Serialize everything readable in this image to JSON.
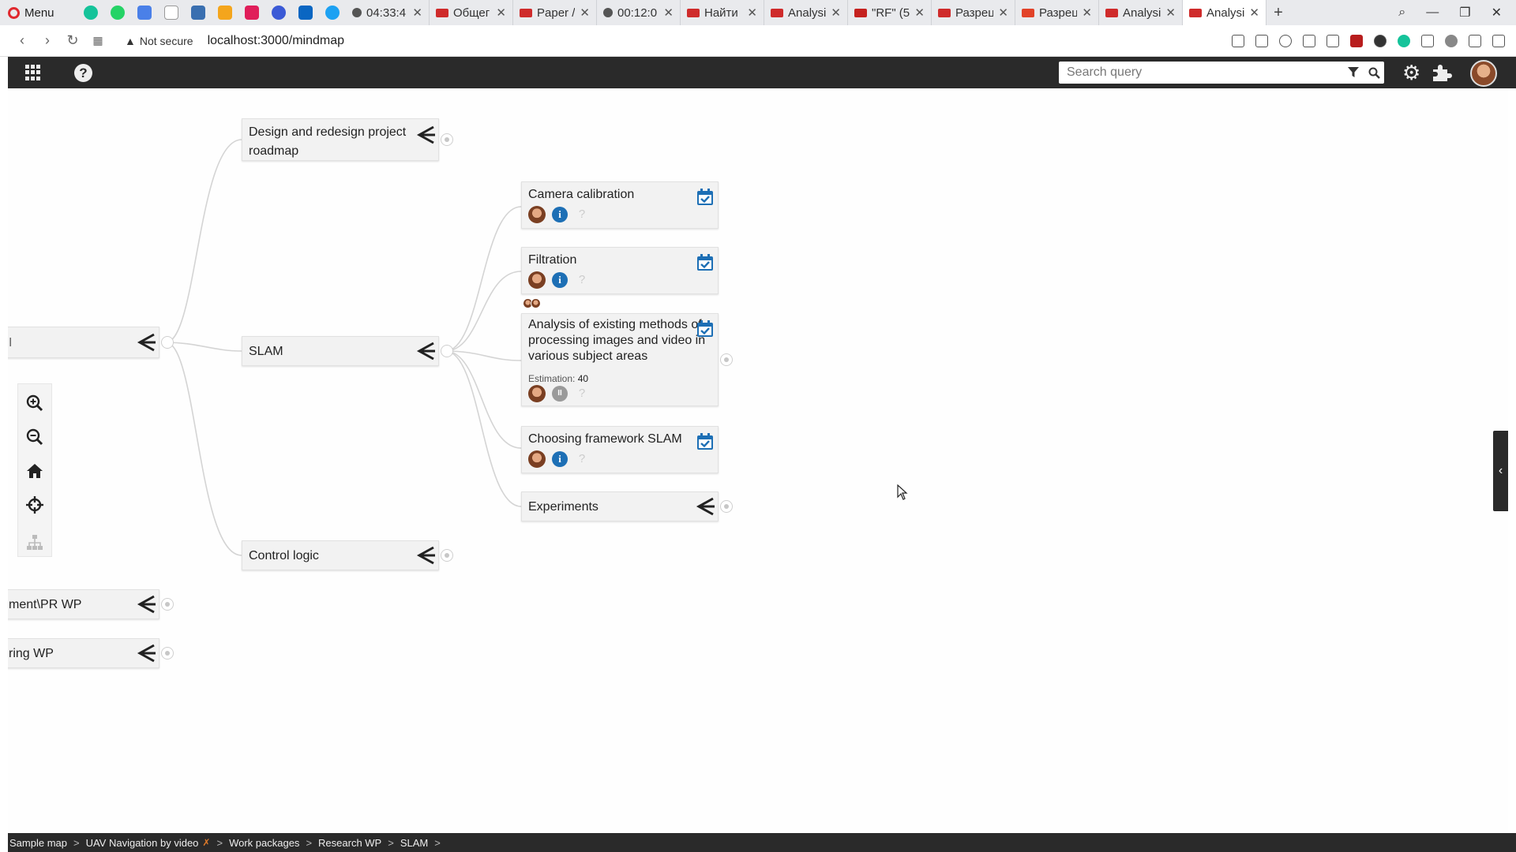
{
  "browser": {
    "menu_label": "Menu",
    "tabs": [
      {
        "title": "04:33:4",
        "type": "clock"
      },
      {
        "title": "Общег",
        "type": "app"
      },
      {
        "title": "Paper /",
        "type": "app"
      },
      {
        "title": "00:12:0",
        "type": "clock"
      },
      {
        "title": "Найти",
        "type": "app"
      },
      {
        "title": "Analysi",
        "type": "app"
      },
      {
        "title": "\"RF\" (5(",
        "type": "mail"
      },
      {
        "title": "Разрец",
        "type": "app"
      },
      {
        "title": "Разрец",
        "type": "gitlab"
      },
      {
        "title": "Analysi",
        "type": "app"
      },
      {
        "title": "Analysi",
        "type": "app",
        "active": true
      }
    ],
    "security_label": "Not secure",
    "url": "localhost:3000/mindmap"
  },
  "appbar": {
    "search_placeholder": "Search query",
    "help_glyph": "?"
  },
  "mindmap": {
    "root_partial": "",
    "root_left_glyph": "I",
    "branch_nodes": [
      {
        "id": "design",
        "title_line1": "Design and redesign project",
        "title_line2": "roadmap"
      },
      {
        "id": "slam",
        "title": "SLAM"
      },
      {
        "id": "control",
        "title": "Control logic"
      }
    ],
    "task_nodes": [
      {
        "id": "camera",
        "title": "Camera calibration",
        "status": "info"
      },
      {
        "id": "filtration",
        "title": "Filtration",
        "status": "info"
      },
      {
        "id": "analysis",
        "title_lines": [
          "Analysis of existing methods of",
          "processing images and video in",
          "various subject areas"
        ],
        "estimation_label": "Estimation:",
        "estimation_value": "40",
        "status": "paused"
      },
      {
        "id": "choosing",
        "title": "Choosing framework SLAM",
        "status": "info"
      }
    ],
    "experiments": {
      "title": "Experiments"
    },
    "left_partials": [
      {
        "id": "pr",
        "title": "ment\\PR WP"
      },
      {
        "id": "ring",
        "title": "ring WP"
      }
    ],
    "icons": {
      "share": "share-icon",
      "calendar": "calendar-check-icon",
      "info": "i",
      "pause": "II",
      "unknown": "?"
    }
  },
  "breadcrumb": {
    "items": [
      "Sample map",
      "UAV Navigation by video",
      "Work packages",
      "Research WP",
      "SLAM"
    ],
    "separator": ">"
  },
  "colors": {
    "accent": "#1d6fb5",
    "dark_bar": "#2a2a2a",
    "node_bg": "#f2f2f2",
    "orange": "#e07b2a"
  }
}
